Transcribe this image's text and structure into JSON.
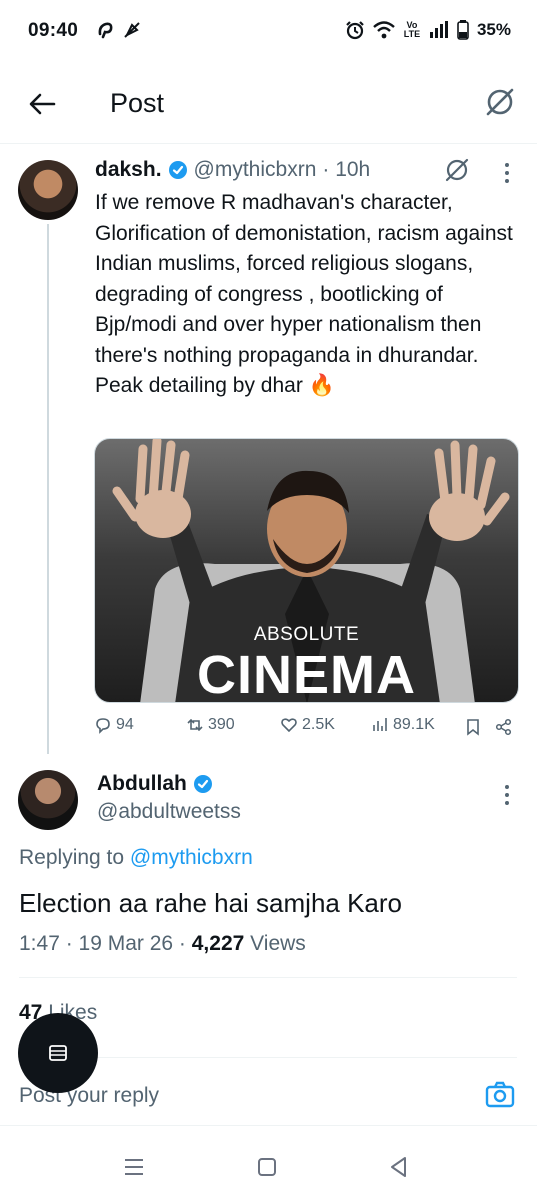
{
  "status": {
    "time": "09:40",
    "network": "Vo LTE",
    "battery": "35%"
  },
  "header": {
    "title": "Post"
  },
  "parent_tweet": {
    "name": "daksh.",
    "handle": "@mythicbxrn",
    "time": "· 10h",
    "text": "If we remove R madhavan's character, Glorification of demonistation, racism against Indian muslims, forced religious slogans, degrading of congress , bootlicking of Bjp/modi and over hyper nationalism then there's nothing propaganda in dhurandar.\n Peak detailing by dhar 🔥",
    "media": {
      "top_text": "ABSOLUTE",
      "big_text": "CINEMA"
    },
    "stats": {
      "replies": "94",
      "reposts": "390",
      "likes": "2.5K",
      "views": "89.1K"
    }
  },
  "main_tweet": {
    "name": "Abdullah",
    "handle": "@abdultweetss",
    "replying_label": "Replying to ",
    "replying_to": "@mythicbxrn",
    "text": "Election aa rahe hai samjha Karo",
    "time_date": "1:47 · 19 Mar 26 · ",
    "views_count": "4,227",
    "views_label": " Views",
    "likes_count": "47",
    "likes_label": " Likes"
  },
  "reply_bar": {
    "placeholder": "Post your reply"
  },
  "colors": {
    "accent": "#1d9bf0",
    "text": "#0f1419",
    "secondary": "#536471"
  }
}
